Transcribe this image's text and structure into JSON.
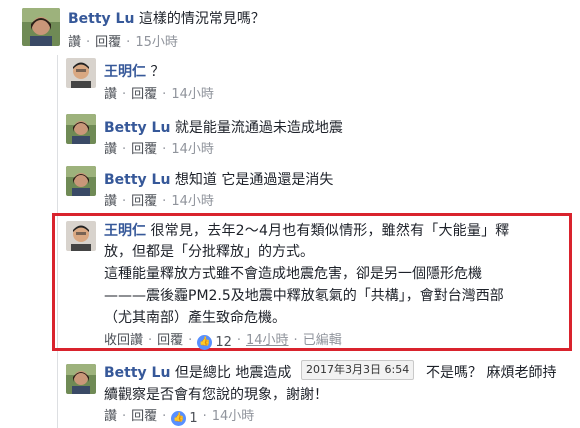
{
  "comments": [
    {
      "author": "Betty Lu",
      "text": "這樣的情況常見嗎？",
      "like": "讚",
      "reply": "回覆",
      "time": "15小時"
    },
    {
      "author": "王明仁",
      "text": "？",
      "like": "讚",
      "reply": "回覆",
      "time": "14小時"
    },
    {
      "author": "Betty Lu",
      "text": "就是能量流通過未造成地震",
      "like": "讚",
      "reply": "回覆",
      "time": "14小時"
    },
    {
      "author": "Betty Lu",
      "text": "想知道 它是通過還是消失",
      "like": "讚",
      "reply": "回覆",
      "time": "14小時"
    },
    {
      "author": "王明仁",
      "lines": [
        "很常見，去年2～4月也有類似情形，雖然有「大能量」釋",
        "放，但都是「分批釋放」的方式。",
        "這種能量釋放方式雖不會造成地震危害，卻是另一個隱形危機",
        "———震後霾PM2.5及地震中釋放氡氣的「共構」，會對台灣西部",
        "（尤其南部）產生致命危機。"
      ],
      "unlike": "收回讚",
      "reply": "回覆",
      "like_count": "12",
      "time": "14小時",
      "edited": "已編輯"
    },
    {
      "author": "Betty Lu",
      "lines": [
        "但是總比 地震造成",
        "不是嗎？ 麻煩老師持",
        "續觀察是否會有您說的現象，謝謝！"
      ],
      "like": "讚",
      "reply": "回覆",
      "like_count": "1",
      "time": "14小時"
    }
  ],
  "tooltip": "2017年3月3日 6:54",
  "colors": {
    "name": "#365899",
    "link": "#4b4f56",
    "meta": "#90949c",
    "highlight": "#d9232d",
    "like_badge": "#5890ff"
  }
}
